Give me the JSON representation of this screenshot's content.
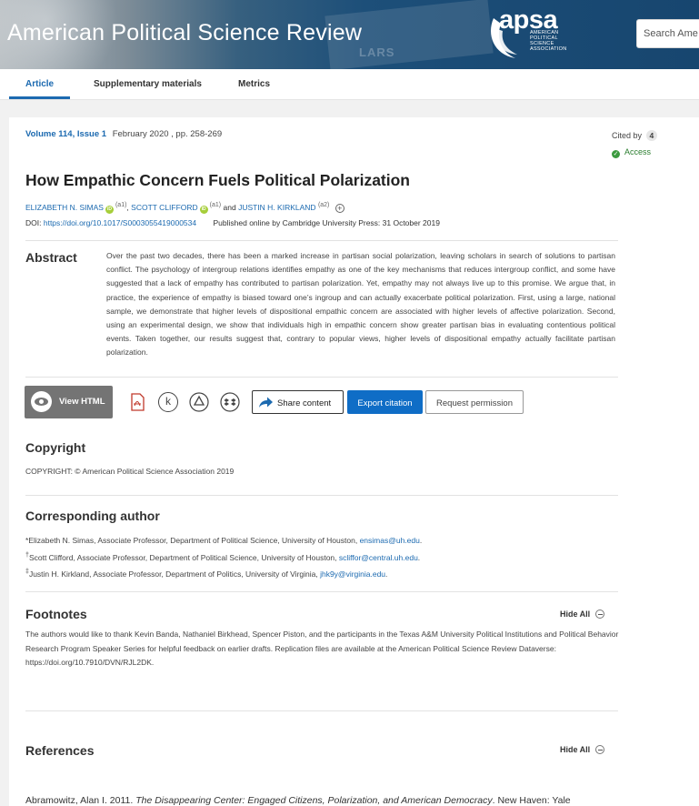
{
  "journal": {
    "title": "American Political Science Review"
  },
  "logo": {
    "name": "apsa",
    "subtitle_lines": [
      "American",
      "Political",
      "Science",
      "Association"
    ]
  },
  "search": {
    "placeholder": "Search Ame"
  },
  "tabs": [
    {
      "label": "Article",
      "active": true
    },
    {
      "label": "Supplementary materials",
      "active": false
    },
    {
      "label": "Metrics",
      "active": false
    }
  ],
  "article": {
    "volume_issue": "Volume 114, Issue 1",
    "date_pages": "February 2020 , pp. 258-269",
    "cited_by_label": "Cited by",
    "cited_by_count": "4",
    "access_label": "Access",
    "title": "How Empathic Concern Fuels Political Polarization",
    "authors": [
      {
        "name": "ELIZABETH N. SIMAS",
        "affil": "(a1)"
      },
      {
        "name": "SCOTT CLIFFORD",
        "affil": "(a1)"
      },
      {
        "name": "JUSTIN H. KIRKLAND",
        "affil": "(a2)"
      }
    ],
    "authors_and": "and",
    "doi_label": "DOI:",
    "doi_link": "https://doi.org/10.1017/S0003055419000534",
    "published": "Published online by Cambridge University Press: 31 October 2019"
  },
  "abstract": {
    "heading": "Abstract",
    "text": "Over the past two decades, there has been a marked increase in partisan social polarization, leaving scholars in search of solutions to partisan conflict. The psychology of intergroup relations identifies empathy as one of the key mechanisms that reduces intergroup conflict, and some have suggested that a lack of empathy has contributed to partisan polarization. Yet, empathy may not always live up to this promise. We argue that, in practice, the experience of empathy is biased toward one’s ingroup and can actually exacerbate political polarization. First, using a large, national sample, we demonstrate that higher levels of dispositional empathic concern are associated with higher levels of affective polarization. Second, using an experimental design, we show that individuals high in empathic concern show greater partisan bias in evaluating contentious political events. Taken together, our results suggest that, contrary to popular views, higher levels of dispositional empathy actually facilitate partisan polarization."
  },
  "actions": {
    "view_html": "View HTML",
    "icons": [
      "pdf-icon",
      "kindle-icon",
      "google-drive-icon",
      "dropbox-icon"
    ],
    "share": "Share content",
    "export": "Export citation",
    "permission": "Request permission"
  },
  "copyright": {
    "heading": "Copyright",
    "text": "COPYRIGHT: © American Political Science Association 2019"
  },
  "corresponding": {
    "heading": "Corresponding author",
    "entries": [
      {
        "mark": "*",
        "text": "Elizabeth N. Simas, Associate Professor, Department of Political Science, University of Houston,",
        "email": "ensimas@uh.edu"
      },
      {
        "mark": "†",
        "text": "Scott Clifford, Associate Professor, Department of Political Science, University of Houston,",
        "email": "scliffor@central.uh.edu"
      },
      {
        "mark": "‡",
        "text": "Justin H. Kirkland, Associate Professor, Department of Politics, University of Virginia,",
        "email": "jhk9y@virginia.edu"
      }
    ]
  },
  "footnotes": {
    "heading": "Footnotes",
    "hide_all": "Hide All",
    "text": "The authors would like to thank Kevin Banda, Nathaniel Birkhead, Spencer Piston, and the participants in the Texas A&M University Political Institutions and Political Behavior Research Program Speaker Series for helpful feedback on earlier drafts. Replication files are available at the American Political Science Review Dataverse: https://doi.org/10.7910/DVN/RJL2DK."
  },
  "references": {
    "heading": "References",
    "hide_all": "Hide All",
    "first_author": "Abramowitz, Alan I. 2011.",
    "first_title": "The Disappearing Center: Engaged Citizens, Polarization, and American Democracy",
    "first_rest": ". New Haven: Yale"
  }
}
